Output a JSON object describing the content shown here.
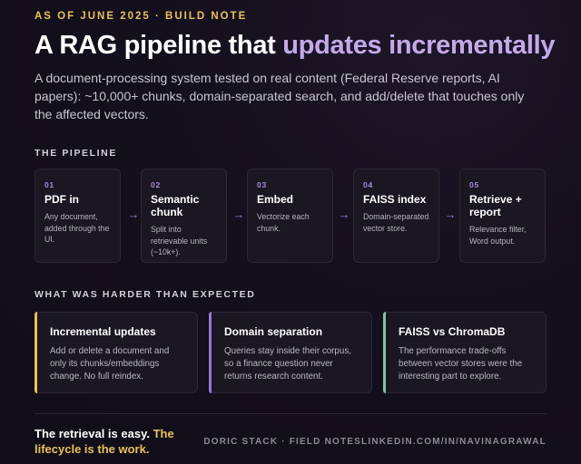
{
  "header": {
    "eyebrow": "AS OF JUNE 2025 · BUILD NOTE",
    "title_plain": "A RAG pipeline that",
    "title_accent": "updates incrementally",
    "lede": "A document-processing system tested on real content (Federal Reserve reports, AI papers): ~10,000+ chunks, domain-separated search, and add/delete that touches only the affected vectors."
  },
  "pipeline": {
    "label": "THE PIPELINE",
    "arrow_glyph": "→",
    "steps": [
      {
        "num": "01",
        "name": "PDF in",
        "desc": "Any document, added through the UI."
      },
      {
        "num": "02",
        "name": "Semantic chunk",
        "desc": "Split into retrievable units (~10k+)."
      },
      {
        "num": "03",
        "name": "Embed",
        "desc": "Vectorize each chunk."
      },
      {
        "num": "04",
        "name": "FAISS index",
        "desc": "Domain-separated vector store."
      },
      {
        "num": "05",
        "name": "Retrieve + report",
        "desc": "Relevance filter, Word output."
      }
    ]
  },
  "harder": {
    "label": "WHAT WAS HARDER THAN EXPECTED",
    "cards": [
      {
        "name": "Incremental updates",
        "desc": "Add or delete a document and only its chunks/embeddings change. No full reindex.",
        "accent": "#e8c15a"
      },
      {
        "name": "Domain separation",
        "desc": "Queries stay inside their corpus, so a finance question never returns research content.",
        "accent": "#9b74d6"
      },
      {
        "name": "FAISS vs ChromaDB",
        "desc": "The performance trade-offs between vector stores were the interesting part to explore.",
        "accent": "#7fc79a"
      }
    ]
  },
  "footer": {
    "closing_plain": "The retrieval is easy.",
    "closing_accent": "The lifecycle is the work.",
    "signature": "DORIC STACK · FIELD NOTESLINKEDIN.COM/IN/NAVINAGRAWAL"
  },
  "colors": {
    "background": "#140f1c",
    "gold": "#e8c15a",
    "lavender": "#c4a9ea",
    "purple": "#9b74d6",
    "green": "#7fc79a"
  }
}
